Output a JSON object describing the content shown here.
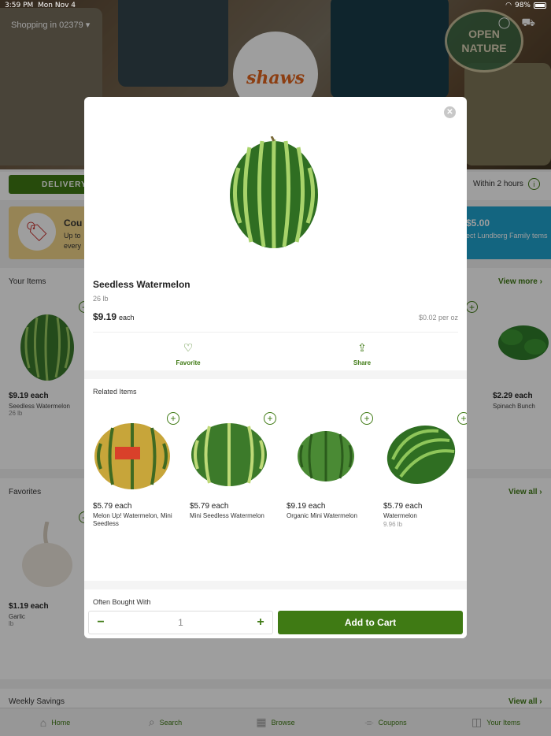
{
  "status_bar": {
    "time": "3:59 PM",
    "date": "Mon Nov 4",
    "battery": "98%"
  },
  "header": {
    "shopping_in": "Shopping in 02379",
    "logo": "shaws",
    "brand_badge": "OPEN NATURE"
  },
  "delivery": {
    "button_label": "DELIVERY",
    "within": "Within 2 hours"
  },
  "coupon_card": {
    "title": "Cou",
    "sub": "Up to every"
  },
  "promo_card": {
    "amount": "$5.00",
    "sub": "ect Lundberg Family tems"
  },
  "your_items": {
    "title": "Your Items",
    "view_label": "View more ›",
    "left": {
      "price": "$9.19 each",
      "name": "Seedless Watermelon",
      "size": "26 lb"
    },
    "right": {
      "price": "$2.29 each",
      "name": "Spinach Bunch"
    }
  },
  "favorites": {
    "title": "Favorites",
    "view_label": "View all ›",
    "left": {
      "price": "$1.19 each",
      "name": "Garlic",
      "size": "lb"
    }
  },
  "weekly": {
    "title": "Weekly Savings",
    "view_label": "View all ›"
  },
  "tabs": [
    {
      "label": "Home",
      "icon": "home-icon"
    },
    {
      "label": "Search",
      "icon": "search-icon"
    },
    {
      "label": "Browse",
      "icon": "grid-icon"
    },
    {
      "label": "Coupons",
      "icon": "tag-icon"
    },
    {
      "label": "Your Items",
      "icon": "basket-icon"
    }
  ],
  "modal": {
    "product": {
      "name": "Seedless Watermelon",
      "weight": "26 lb",
      "price": "$9.19",
      "price_suffix": "each",
      "unit_price": "$0.02 per oz"
    },
    "actions": {
      "favorite": "Favorite",
      "share": "Share"
    },
    "related_title": "Related Items",
    "related": [
      {
        "price": "$5.79 each",
        "name": "Melon Up! Watermelon, Mini Seedless",
        "size": ""
      },
      {
        "price": "$5.79 each",
        "name": "Mini Seedless Watermelon",
        "size": ""
      },
      {
        "price": "$9.19 each",
        "name": "Organic Mini Watermelon",
        "size": ""
      },
      {
        "price": "$5.79 each",
        "name": "Watermelon",
        "size": "9.96 lb"
      }
    ],
    "often_title": "Often Bought With",
    "quantity": "1",
    "add_to_cart": "Add to Cart"
  },
  "colors": {
    "brand_green": "#3f7a14",
    "coupon_yellow": "#f2d68a",
    "promo_blue": "#1fa3cf"
  }
}
